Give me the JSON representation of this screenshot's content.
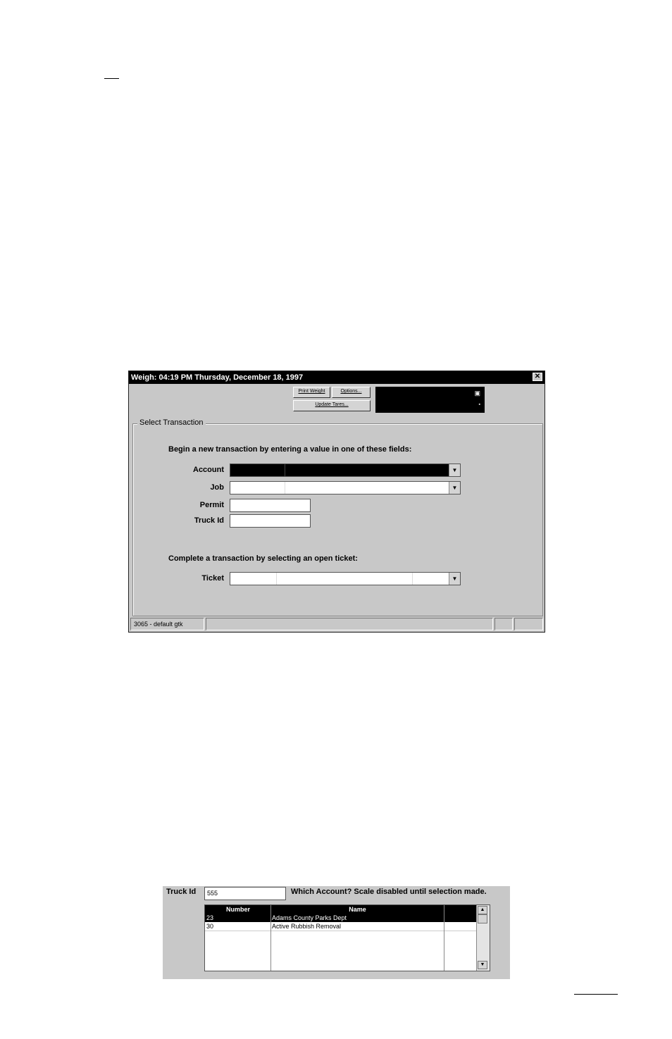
{
  "window": {
    "title": "Weigh:   04:19 PM    Thursday, December 18, 1997",
    "close_glyph": "✕",
    "toolbar": {
      "print_weight": "Print Weight",
      "options": "Options...",
      "update_tares": "Update Tares..."
    },
    "weight_display": {
      "icon": "page-icon",
      "mark": "▪"
    },
    "group_label": "Select Transaction",
    "new_instruction": "Begin a new transaction by entering a value in one of these fields:",
    "fields": {
      "account_label": "Account",
      "job_label": "Job",
      "permit_label": "Permit",
      "truck_label": "Truck Id",
      "ticket_label": "Ticket"
    },
    "complete_instruction": "Complete a transaction by selecting an open ticket:",
    "status": {
      "pane1": "3065 - default gtk"
    }
  },
  "lookup": {
    "truck_label": "Truck Id",
    "truck_value": "555",
    "message": "Which Account?  Scale disabled until selection made.",
    "columns": [
      "Number",
      "Name"
    ],
    "rows": [
      {
        "number": "23",
        "name": "Adams County Parks Dept"
      },
      {
        "number": "30",
        "name": "Active Rubbish Removal"
      }
    ]
  },
  "colors": {
    "window_bg": "#c8c8c8",
    "titlebar": "#000000",
    "selection": "#000000"
  }
}
